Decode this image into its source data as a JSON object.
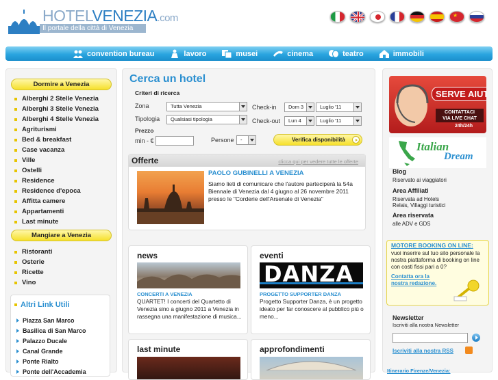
{
  "header": {
    "logo_word_a": "HOTEL",
    "logo_word_b": "VENEZIA",
    "logo_word_c": ".com",
    "tagline": "Il portale della città di Venezia",
    "languages": [
      "italiano",
      "english",
      "japanese",
      "français",
      "deutsch",
      "español",
      "chinese",
      "russian"
    ]
  },
  "nav": {
    "items": [
      {
        "label": "convention bureau",
        "icon": "people-icon"
      },
      {
        "label": "lavoro",
        "icon": "worker-icon"
      },
      {
        "label": "musei",
        "icon": "museum-icon"
      },
      {
        "label": "cinema",
        "icon": "film-icon"
      },
      {
        "label": "teatro",
        "icon": "masks-icon"
      },
      {
        "label": "immobili",
        "icon": "house-icon"
      }
    ]
  },
  "left": {
    "section1": "Dormire a Venezia",
    "dormire": [
      "Alberghi 2 Stelle Venezia",
      "Alberghi 3 Stelle Venezia",
      "Alberghi 4 Stelle Venezia",
      "Agriturismi",
      "Bed & breakfast",
      "Case vacanza",
      "Ville",
      "Ostelli",
      "Residence",
      "Residence d'epoca",
      "Affitta camere",
      "Appartamenti",
      "Last minute"
    ],
    "section2": "Mangiare a Venezia",
    "mangiare": [
      "Ristoranti",
      "Osterie",
      "Ricette",
      "Vino"
    ],
    "altri_title": "Altri Link Utili",
    "altri": [
      "Piazza San Marco",
      "Basilica di San Marco",
      "Palazzo Ducale",
      "Canal Grande",
      "Ponte Rialto",
      "Ponte dell'Accademia"
    ]
  },
  "search": {
    "title": "Cerca un hotel",
    "criteri": "Criteri di ricerca",
    "zona_label": "Zona",
    "zona_value": "Tutta Venezia",
    "tipologia_label": "Tipologia",
    "tipologia_value": "Qualsiasi tipologia",
    "prezzo_label": "Prezzo",
    "min_label": "min - €",
    "checkin_label": "Check-in",
    "checkin_day": "Dom 3",
    "checkin_month": "Luglio '11",
    "checkout_label": "Check-out",
    "checkout_day": "Lun 4",
    "checkout_month": "Luglio '11",
    "persone_label": "Persone",
    "persone_value": "-",
    "submit": "Verifica disponibilità"
  },
  "offerte": {
    "title": "Offerte",
    "link": "clicca qui per vedere tutte le offerte",
    "headline": "PAOLO GUBINELLI A VENEZIA",
    "text": "Siamo lieti di comunicare che l'autore parteciperà la 54a Biennale di Venezia dal 4 giugno al 26 novembre 2011 presso le \"Corderie dell'Arsenale di Venezia\""
  },
  "boxes": {
    "news": {
      "title": "news",
      "sub": "CONCERTI A VENEZIA",
      "text": "QUARTET! I concerti del Quartetto di Venezia sino a giugno 2011 a Venezia in rassegna una manifestazione di musica..."
    },
    "eventi": {
      "title": "eventi",
      "sub": "PROGETTO SUPPORTER DANZA",
      "banner": "DANZA",
      "text": "Progetto Supporter Danza, è un progetto ideato per far conoscere al pubblico più o meno..."
    },
    "lastminute": {
      "title": "last minute"
    },
    "approfondimenti": {
      "title": "approfondimenti"
    }
  },
  "right": {
    "serve_title": "SERVE AIUTO?",
    "serve_sub1": "CONTATTACI",
    "serve_sub2": "VIA LIVE CHAT",
    "serve_sub3": "24h/24h",
    "italian_dream_a": "Italian",
    "italian_dream_b": "Dream",
    "blog_title": "Blog",
    "blog_text": "Riservato ai viaggiatori",
    "affiliati_title": "Area Affiliati",
    "affiliati_text1": "Riservata ad Hotels",
    "affiliati_text2": "Relais, Villaggi turistici",
    "riservata_title": "Area riservata",
    "riservata_text": "alle ADV e GDS",
    "motore_title": "MOTORE BOOKING ON LINE:",
    "motore_text": "vuoi inserire sul tuo sito personale la nostra piattaforma di booking on line con costi fissi pari a 0?",
    "motore_link1": "Contatta ora la",
    "motore_link2": "nostra redazione.",
    "newsletter_title": "Newsletter",
    "newsletter_text": "Iscriviti alla nostra Newsletter",
    "rss_text": "Iscriviti alla nostra RSS",
    "itinerario": "Itinerario Firenze/Venezia:"
  }
}
